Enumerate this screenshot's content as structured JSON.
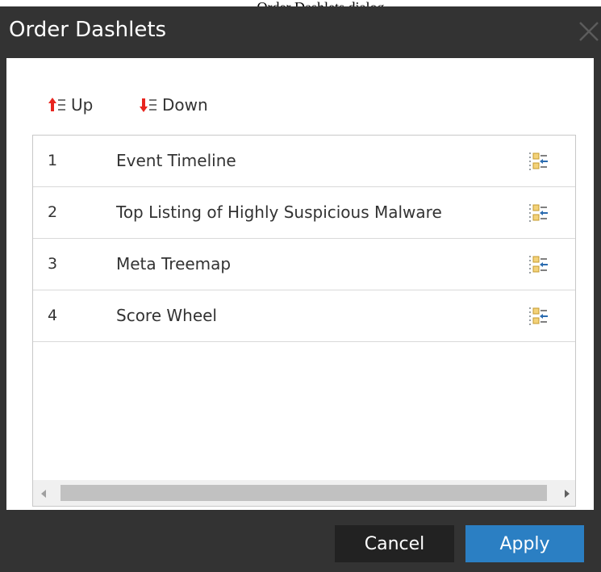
{
  "top_caption": "Order Dashlets dialog",
  "dialog": {
    "title": "Order Dashlets",
    "close_icon": "close-icon"
  },
  "toolbar": {
    "up_label": "Up",
    "down_label": "Down",
    "up_icon": "move-up-icon",
    "down_icon": "move-down-icon",
    "arrow_color": "#e8251f"
  },
  "dashlets": [
    {
      "order": "1",
      "name": "Event Timeline"
    },
    {
      "order": "2",
      "name": "Top Listing of Highly Suspicious Malware"
    },
    {
      "order": "3",
      "name": "Meta Treemap"
    },
    {
      "order": "4",
      "name": "Score Wheel"
    }
  ],
  "row_icon": "reorder-icon",
  "footer": {
    "cancel_label": "Cancel",
    "apply_label": "Apply"
  },
  "colors": {
    "dialog_background": "#333333",
    "apply_button": "#2b7fc3",
    "cancel_button": "#222222"
  }
}
